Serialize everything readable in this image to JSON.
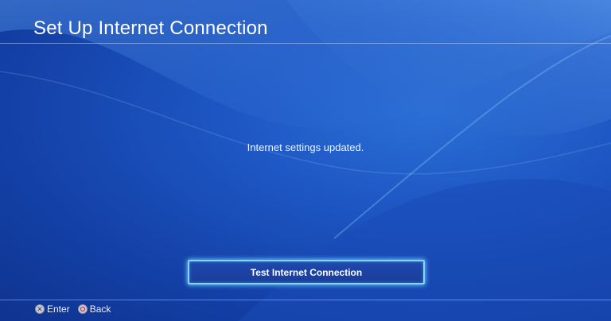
{
  "header": {
    "title": "Set Up Internet Connection"
  },
  "main": {
    "message": "Internet settings updated.",
    "primary_button_label": "Test Internet Connection"
  },
  "footer": {
    "hints": [
      {
        "icon": "cross-button-icon",
        "label": "Enter"
      },
      {
        "icon": "circle-button-icon",
        "label": "Back"
      }
    ]
  },
  "colors": {
    "background": "#1d55c2",
    "focus_highlight": "#7fd7ff",
    "circle_symbol": "#c8102e"
  }
}
